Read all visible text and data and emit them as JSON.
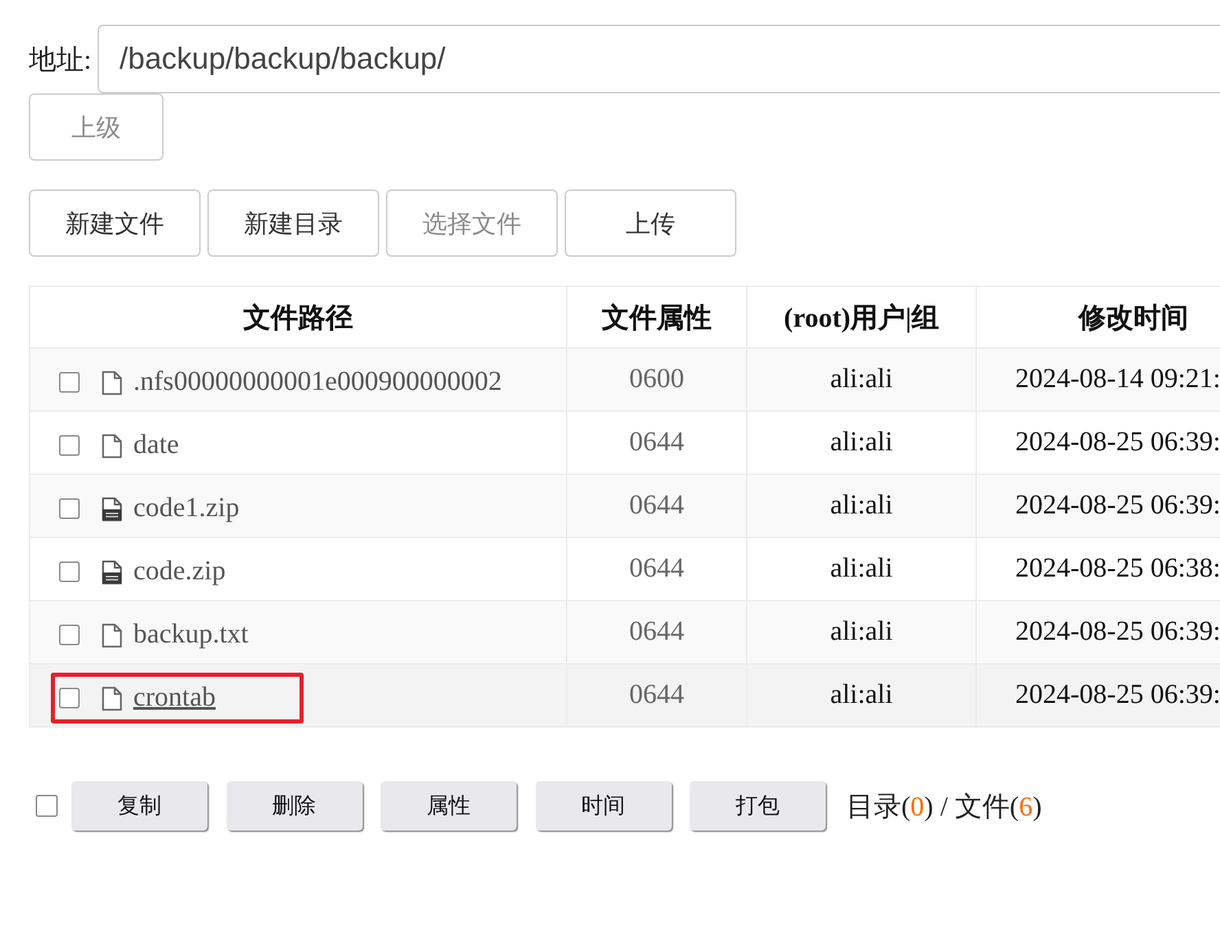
{
  "address": {
    "label": "地址:",
    "value": "/backup/backup/backup/"
  },
  "parent_button": {
    "label": "上级",
    "disabled": true
  },
  "toolbar": [
    {
      "label": "新建文件",
      "disabled": false
    },
    {
      "label": "新建目录",
      "disabled": false
    },
    {
      "label": "选择文件",
      "disabled": true
    },
    {
      "label": "上传",
      "disabled": false
    }
  ],
  "table": {
    "columns": [
      "文件路径",
      "文件属性",
      "(root)用户|组",
      "修改时间"
    ],
    "rows": [
      {
        "kind": "file",
        "checked": false,
        "hovered": false,
        "highlighted": false,
        "name": ".nfs00000000001e000900000002",
        "mode": "0600",
        "owner": "ali:ali",
        "modified": "2024-08-14 09:21:"
      },
      {
        "kind": "file",
        "checked": false,
        "hovered": false,
        "highlighted": false,
        "name": "date",
        "mode": "0644",
        "owner": "ali:ali",
        "modified": "2024-08-25 06:39:"
      },
      {
        "kind": "archive",
        "checked": false,
        "hovered": false,
        "highlighted": false,
        "name": "code1.zip",
        "mode": "0644",
        "owner": "ali:ali",
        "modified": "2024-08-25 06:39:"
      },
      {
        "kind": "archive",
        "checked": false,
        "hovered": false,
        "highlighted": false,
        "name": "code.zip",
        "mode": "0644",
        "owner": "ali:ali",
        "modified": "2024-08-25 06:38:"
      },
      {
        "kind": "file",
        "checked": false,
        "hovered": false,
        "highlighted": false,
        "name": "backup.txt",
        "mode": "0644",
        "owner": "ali:ali",
        "modified": "2024-08-25 06:39:"
      },
      {
        "kind": "file",
        "checked": false,
        "hovered": true,
        "highlighted": true,
        "name": "crontab",
        "mode": "0644",
        "owner": "ali:ali",
        "modified": "2024-08-25 06:39:"
      }
    ]
  },
  "batch": {
    "select_all": {
      "checked": false
    },
    "buttons": [
      "复制",
      "删除",
      "属性",
      "时间",
      "打包"
    ],
    "summary": [
      {
        "kind": "plain",
        "text": "目录("
      },
      {
        "kind": "count",
        "text": "0"
      },
      {
        "kind": "plain",
        "text": ") / 文件("
      },
      {
        "kind": "count",
        "text": "6"
      },
      {
        "kind": "plain",
        "text": ")"
      }
    ]
  }
}
